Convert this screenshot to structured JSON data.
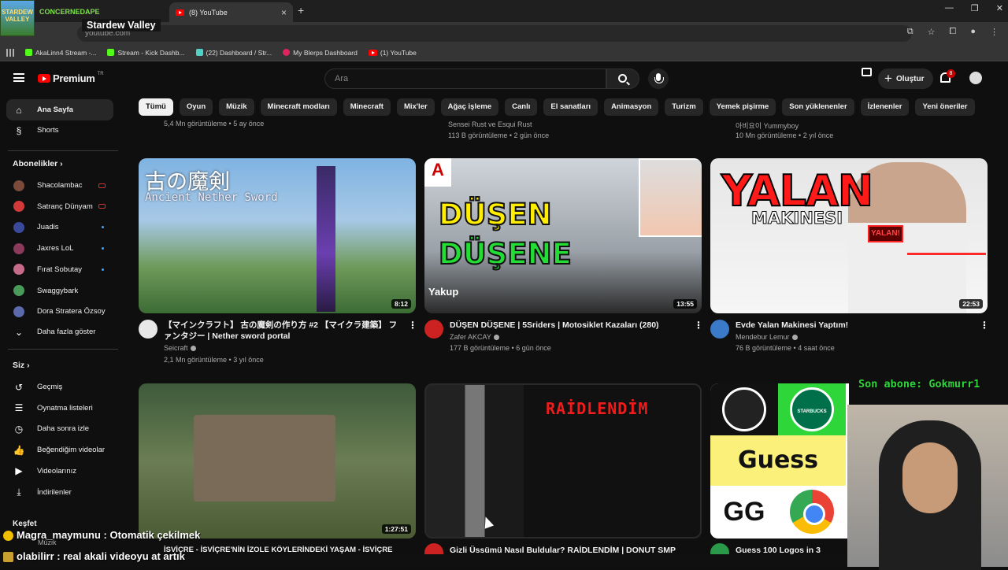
{
  "browser": {
    "tab_title": "(8) YouTube",
    "url_partial": "youtube.com",
    "bookmarks": [
      {
        "label": "AkaLinn4 Stream -..."
      },
      {
        "label": "Stream - Kick Dashb..."
      },
      {
        "label": "(22) Dashboard / Str..."
      },
      {
        "label": "My Blerps Dashboard"
      },
      {
        "label": "(1) YouTube"
      }
    ]
  },
  "stream_overlay": {
    "logo_text": "STARDEW VALLEY",
    "channel": "CONCERNEDAPE",
    "game": "Stardew Valley",
    "subscriber_banner": "Son abone: Gokmurr1",
    "chat": [
      {
        "user": "Magra_maymunu",
        "message": "Otomatik çekilmek"
      },
      {
        "user": "olabilirr",
        "message": "real akali videoyu at artık"
      }
    ]
  },
  "header": {
    "logo_text": "Premium",
    "logo_region": "TR",
    "search_placeholder": "Ara",
    "create_label": "Oluştur",
    "notification_count": "8"
  },
  "chips": [
    "Tümü",
    "Oyun",
    "Müzik",
    "Minecraft modları",
    "Minecraft",
    "Mix'ler",
    "Ağaç işleme",
    "Canlı",
    "El sanatları",
    "Animasyon",
    "Turizm",
    "Yemek pişirme",
    "Son yüklenenler",
    "İzlenenler",
    "Yeni öneriler"
  ],
  "sidebar": {
    "home": "Ana Sayfa",
    "shorts": "Shorts",
    "subscriptions_heading": "Abonelikler",
    "subscriptions": [
      {
        "name": "Shacolambac",
        "status": "live",
        "color": "#7a4a3a"
      },
      {
        "name": "Satranç Dünyam",
        "status": "live",
        "color": "#d23a3a"
      },
      {
        "name": "Juadis",
        "status": "new",
        "color": "#3a4a9a"
      },
      {
        "name": "Jaxres LoL",
        "status": "new",
        "color": "#8a3a5a"
      },
      {
        "name": "Fırat Sobutay",
        "status": "new",
        "color": "#c86a8a"
      },
      {
        "name": "Swaggybark",
        "status": "",
        "color": "#4a9a5a"
      },
      {
        "name": "Dora Stratera Özsoy",
        "status": "",
        "color": "#5a6aaa"
      }
    ],
    "show_more": "Daha fazla göster",
    "you_heading": "Siz",
    "you_items": [
      {
        "label": "Geçmiş",
        "icon": "history-icon",
        "glyph": "↺"
      },
      {
        "label": "Oynatma listeleri",
        "icon": "playlists-icon",
        "glyph": "☰"
      },
      {
        "label": "Daha sonra izle",
        "icon": "watch-later-icon",
        "glyph": "◷"
      },
      {
        "label": "Beğendiğim videolar",
        "icon": "like-icon",
        "glyph": "👍"
      },
      {
        "label": "Videolarınız",
        "icon": "your-videos-icon",
        "glyph": "▶"
      },
      {
        "label": "İndirilenler",
        "icon": "downloads-icon",
        "glyph": "⤓"
      }
    ],
    "explore_heading": "Keşfet",
    "explore_music": "Müzik"
  },
  "prev_row": [
    {
      "channel": "",
      "meta": "5,4 Mn görüntüleme • 5 ay önce"
    },
    {
      "channel": "Sensei Rust ve Esqui Rust",
      "meta": "113 B görüntüleme • 2 gün önce"
    },
    {
      "channel": "아비요이 Yummyboy",
      "meta": "10 Mn görüntüleme • 2 yıl önce"
    }
  ],
  "videos": [
    {
      "title": "【マインクラフト】 古の魔剣の作り方 #2 【マイクラ建築】 ファンタジー | Nether sword portal",
      "channel": "Seicraft",
      "meta": "2,1 Mn görüntüleme • 3 yıl önce",
      "duration": "8:12",
      "thumb_jp": "古の魔剣",
      "thumb_en": "Ancient Nether Sword",
      "avatar_color": "#e8e8e8"
    },
    {
      "title": "DÜŞEN DÜŞENE | 5Sriders | Motosiklet Kazaları (280)",
      "channel": "Zafer AKCAY",
      "meta": "177 B görüntüleme • 6 gün önce",
      "duration": "13:55",
      "thumb_line1": "DÜŞEN",
      "thumb_line2": "DÜŞENE",
      "thumb_name": "Yakup",
      "avatar_color": "#cc2222"
    },
    {
      "title": "Evde Yalan Makinesi Yaptım!",
      "channel": "Mendebur Lemur",
      "meta": "76 B görüntüleme • 4 saat önce",
      "duration": "22:53",
      "thumb_big": "YALAN",
      "thumb_small": "MAKINESI",
      "thumb_box": "YALAN!",
      "avatar_color": "#3a7ac8"
    },
    {
      "title": "İSVİÇRE - İSVİÇRE'NİN İZOLE KÖYLERİNDEKİ YAŞAM - İSVİÇRE",
      "channel": "",
      "meta": "",
      "duration": "1:27:51",
      "avatar_color": "#7a5a3a"
    },
    {
      "title": "Gizli Üssümü Nasıl Buldular? RAİDLENDİM | DONUT SMP",
      "channel": "",
      "meta": "",
      "duration": "",
      "thumb_word": "RAİDLENDİM",
      "avatar_color": "#cc2222"
    },
    {
      "title": "Guess 100 Logos in 3 Second...",
      "channel": "",
      "meta": "",
      "duration": "",
      "thumb_word": "Guess 100",
      "thumb_sbux": "STARBUCKS COFFEE",
      "avatar_color": "#2a9a4a"
    }
  ]
}
